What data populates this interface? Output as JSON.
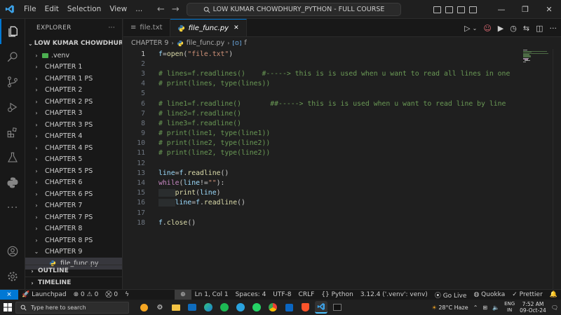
{
  "titlebar": {
    "menu": [
      "File",
      "Edit",
      "Selection",
      "View",
      "..."
    ],
    "search_text": "LOW KUMAR CHOWDHURY_PYTHON - FULL COURSE"
  },
  "sidebar": {
    "title": "EXPLORER",
    "more": "···",
    "folder": "LOW KUMAR CHOWDHURY_...",
    "items": [
      {
        "label": ".venv",
        "kind": "folder-venv",
        "open": false
      },
      {
        "label": "CHAPTER 1",
        "kind": "folder",
        "open": false
      },
      {
        "label": "CHAPTER 1 PS",
        "kind": "folder",
        "open": false
      },
      {
        "label": "CHAPTER 2",
        "kind": "folder",
        "open": false
      },
      {
        "label": "CHAPTER 2 PS",
        "kind": "folder",
        "open": false
      },
      {
        "label": "CHAPTER 3",
        "kind": "folder",
        "open": false
      },
      {
        "label": "CHAPTER 3 PS",
        "kind": "folder",
        "open": false
      },
      {
        "label": "CHAPTER 4",
        "kind": "folder",
        "open": false
      },
      {
        "label": "CHAPTER 4 PS",
        "kind": "folder",
        "open": false
      },
      {
        "label": "CHAPTER 5",
        "kind": "folder",
        "open": false
      },
      {
        "label": "CHAPTER 5 PS",
        "kind": "folder",
        "open": false
      },
      {
        "label": "CHAPTER 6",
        "kind": "folder",
        "open": false
      },
      {
        "label": "CHAPTER 6 PS",
        "kind": "folder",
        "open": false
      },
      {
        "label": "CHAPTER 7",
        "kind": "folder",
        "open": false
      },
      {
        "label": "CHAPTER 7 PS",
        "kind": "folder",
        "open": false
      },
      {
        "label": "CHAPTER 8",
        "kind": "folder",
        "open": false
      },
      {
        "label": "CHAPTER 8 PS",
        "kind": "folder",
        "open": false
      },
      {
        "label": "CHAPTER 9",
        "kind": "folder",
        "open": true
      },
      {
        "label": "file_func.py",
        "kind": "python-file",
        "selected": true
      }
    ],
    "outline": "OUTLINE",
    "timeline": "TIMELINE"
  },
  "tabs": [
    {
      "label": "file.txt",
      "active": false
    },
    {
      "label": "file_func.py",
      "active": true,
      "close": "✕"
    }
  ],
  "breadcrumb": {
    "folder": "CHAPTER 9",
    "file": "file_func.py",
    "symbol": "f"
  },
  "code_lines": [
    {
      "n": "1",
      "text": "f=open(\"file.txt\")"
    },
    {
      "n": "2",
      "text": ""
    },
    {
      "n": "3",
      "text": "# lines=f.readlines()    #-----> this is is used when u want to read all lines in one"
    },
    {
      "n": "4",
      "text": "# print(lines, type(lines))"
    },
    {
      "n": "5",
      "text": ""
    },
    {
      "n": "6",
      "text": "# line1=f.readline()       ##-----> this is is used when u want to read line by line"
    },
    {
      "n": "7",
      "text": "# line2=f.readline()"
    },
    {
      "n": "8",
      "text": "# line3=f.readline()"
    },
    {
      "n": "9",
      "text": "# print(line1, type(line1))"
    },
    {
      "n": "10",
      "text": "# print(line2, type(line2))"
    },
    {
      "n": "11",
      "text": "# print(line2, type(line2))"
    },
    {
      "n": "12",
      "text": ""
    },
    {
      "n": "13",
      "text": "line=f.readline()"
    },
    {
      "n": "14",
      "text": "while(line!=\"\"):"
    },
    {
      "n": "15",
      "text": "    print(line)"
    },
    {
      "n": "16",
      "text": "    line=f.readline()"
    },
    {
      "n": "17",
      "text": ""
    },
    {
      "n": "18",
      "text": "f.close()"
    }
  ],
  "statusbar": {
    "launchpad": "Launchpad",
    "errors": "0",
    "warnings": "0",
    "ports": "0",
    "position": "Ln 1, Col 1",
    "spaces": "Spaces: 4",
    "encoding": "UTF-8",
    "eol": "CRLF",
    "language": "Python",
    "interpreter": "3.12.4 ('.venv': venv)",
    "golive": "Go Live",
    "quokka": "Quokka",
    "prettier": "Prettier"
  },
  "taskbar": {
    "search_placeholder": "Type here to search",
    "weather": "28°C  Haze",
    "lang_top": "ENG",
    "lang_bottom": "IN",
    "time": "7:52 AM",
    "date": "09-Oct-24"
  },
  "colors": {
    "accent": "#0078d4",
    "comment": "#6a9955",
    "keyword": "#c586c0",
    "function": "#dcdcaa",
    "variable": "#9cdcfe",
    "string": "#ce9178"
  }
}
